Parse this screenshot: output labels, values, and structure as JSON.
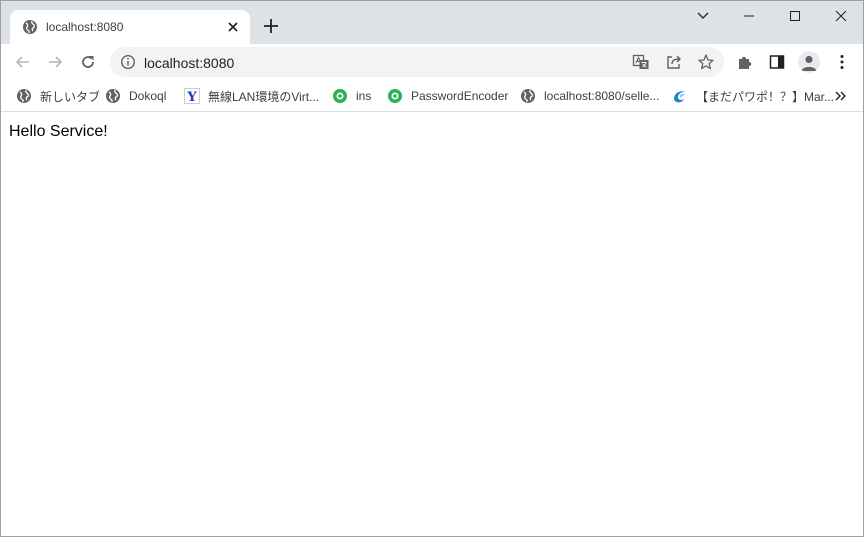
{
  "tab": {
    "title": "localhost:8080"
  },
  "toolbar": {
    "url": "localhost:8080"
  },
  "bookmarks": [
    {
      "label": "新しいタブ",
      "icon": "globe-icon"
    },
    {
      "label": "Dokoql",
      "icon": "globe-icon"
    },
    {
      "label": "無線LAN環境のVirt...",
      "icon": "yahoo-icon"
    },
    {
      "label": "ins",
      "icon": "green-circle-icon"
    },
    {
      "label": "PasswordEncoder",
      "icon": "green-circle-icon"
    },
    {
      "label": "localhost:8080/selle...",
      "icon": "globe-icon"
    },
    {
      "label": "【まだパワポ！？】Mar...",
      "icon": "swirl-icon"
    }
  ],
  "page": {
    "text": "Hello Service!"
  },
  "colors": {
    "tabstrip": "#dee1e6",
    "omnibox": "#f1f3f4",
    "icon": "#5f6368",
    "green_favicon": "#2bb24c",
    "yahoo_blue": "#1a3bb3"
  }
}
